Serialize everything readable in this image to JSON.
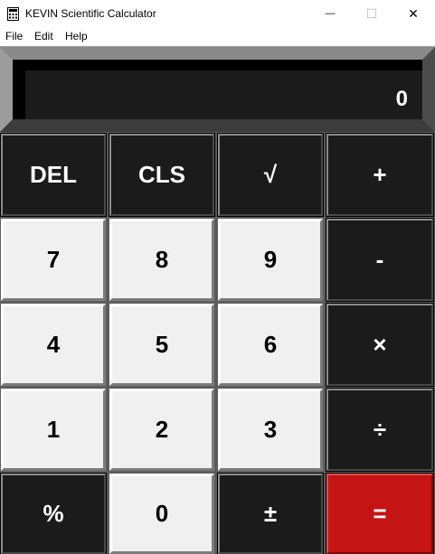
{
  "window": {
    "title": "KEVIN Scientific Calculator",
    "minimize_glyph": "—",
    "maximize_glyph": "☐",
    "close_glyph": "✕"
  },
  "menu": {
    "items": [
      "File",
      "Edit",
      "Help"
    ]
  },
  "display": {
    "value": "0"
  },
  "keypad": {
    "rows": [
      [
        {
          "label": "DEL",
          "style": "dark",
          "name": "delete-button"
        },
        {
          "label": "CLS",
          "style": "dark",
          "name": "clear-button"
        },
        {
          "label": "√",
          "style": "dark",
          "name": "sqrt-button"
        },
        {
          "label": "+",
          "style": "dark",
          "name": "add-button"
        }
      ],
      [
        {
          "label": "7",
          "style": "light",
          "name": "digit-7-button"
        },
        {
          "label": "8",
          "style": "light",
          "name": "digit-8-button"
        },
        {
          "label": "9",
          "style": "light",
          "name": "digit-9-button"
        },
        {
          "label": "-",
          "style": "dark",
          "name": "subtract-button"
        }
      ],
      [
        {
          "label": "4",
          "style": "light",
          "name": "digit-4-button"
        },
        {
          "label": "5",
          "style": "light",
          "name": "digit-5-button"
        },
        {
          "label": "6",
          "style": "light",
          "name": "digit-6-button"
        },
        {
          "label": "×",
          "style": "dark",
          "name": "multiply-button"
        }
      ],
      [
        {
          "label": "1",
          "style": "light",
          "name": "digit-1-button"
        },
        {
          "label": "2",
          "style": "light",
          "name": "digit-2-button"
        },
        {
          "label": "3",
          "style": "light",
          "name": "digit-3-button"
        },
        {
          "label": "÷",
          "style": "dark",
          "name": "divide-button"
        }
      ],
      [
        {
          "label": "%",
          "style": "dark",
          "name": "percent-button"
        },
        {
          "label": "0",
          "style": "light",
          "name": "digit-0-button"
        },
        {
          "label": "±",
          "style": "dark",
          "name": "negate-button"
        },
        {
          "label": "=",
          "style": "red",
          "name": "equals-button"
        }
      ]
    ]
  },
  "colors": {
    "dark_key": "#1b1b1b",
    "light_key": "#f0f0f0",
    "equals_key": "#c41414",
    "display_bg": "#1b1b1b"
  }
}
